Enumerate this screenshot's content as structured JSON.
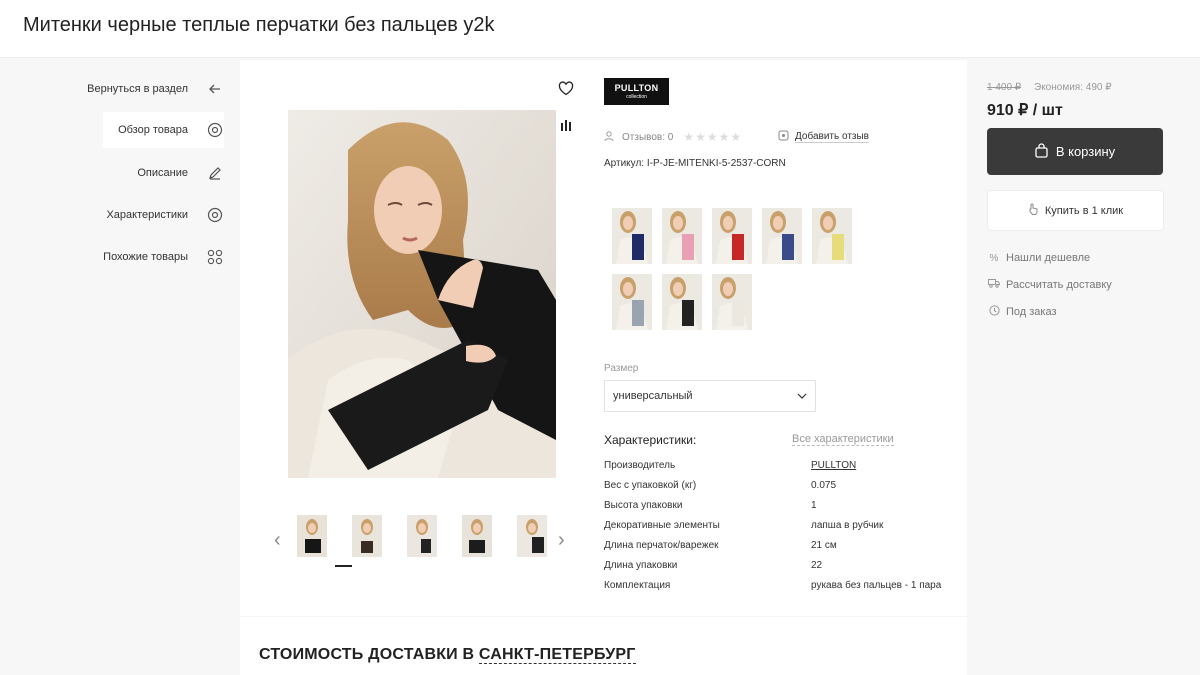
{
  "page": {
    "title": "Митенки черные теплые перчатки без пальцев y2k"
  },
  "nav": {
    "items": [
      {
        "label": "Вернуться в раздел",
        "icon": "arrow-left-icon"
      },
      {
        "label": "Обзор товара",
        "icon": "eye-icon"
      },
      {
        "label": "Описание",
        "icon": "pencil-icon"
      },
      {
        "label": "Характеристики",
        "icon": "eye-icon"
      },
      {
        "label": "Похожие товары",
        "icon": "grid-icon"
      }
    ]
  },
  "product": {
    "brand_logo_text": "PULLTON",
    "brand_logo_sub": "collection",
    "reviews_label": "Отзывов: 0",
    "add_review": "Добавить отзыв",
    "sku": "Артикул: I-P-JE-MITENKI-5-2537-CORN",
    "size_label": "Размер",
    "size_value": "универсальный",
    "specs_title": "Характеристики:",
    "specs_all": "Все характеристики",
    "specs": [
      {
        "key": "Производитель",
        "value": "PULLTON"
      },
      {
        "key": "Вес с упаковкой (кг)",
        "value": "0.075"
      },
      {
        "key": "Высота упаковки",
        "value": "1"
      },
      {
        "key": "Декоративные элементы",
        "value": "лапша в рубчик"
      },
      {
        "key": "Длина перчаток/варежек",
        "value": "21 см"
      },
      {
        "key": "Длина упаковки",
        "value": "22"
      },
      {
        "key": "Комплектация",
        "value": "рукава без пальцев - 1 пара"
      }
    ],
    "variant_colors": [
      "#1f2a66",
      "#e8a0b5",
      "#c62828",
      "#3a4a8a",
      "#e6dc7a",
      "#9aa3b0",
      "#222222",
      "#ece8df"
    ]
  },
  "pricing": {
    "old_price": "1 400 ₽",
    "economy": "Экономия: 490 ₽",
    "price": "910 ₽ / шт",
    "cart_button": "В корзину",
    "oneclick_button": "Купить в 1 клик",
    "links": [
      {
        "label": "Нашли дешевле",
        "icon": "percent-icon"
      },
      {
        "label": "Рассчитать доставку",
        "icon": "truck-icon"
      },
      {
        "label": "Под заказ",
        "icon": "clock-icon"
      }
    ]
  },
  "delivery": {
    "prefix": "СТОИМОСТЬ ДОСТАВКИ В ",
    "city": "САНКТ-ПЕТЕРБУРГ"
  }
}
